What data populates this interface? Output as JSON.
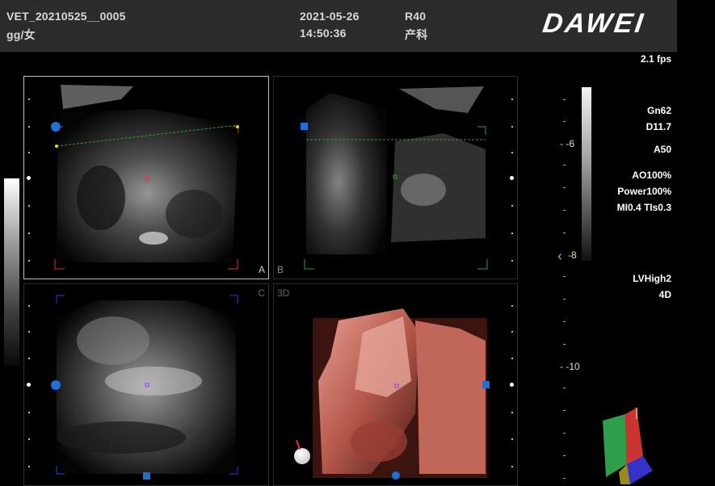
{
  "header": {
    "file_id": "VET_20210525__0005",
    "patient": "gg/女",
    "date": "2021-05-26",
    "time": "14:50:36",
    "probe": "R40",
    "department": "产科",
    "brand": "DAWEI"
  },
  "fps": "2.1 fps",
  "panels": {
    "a": "A",
    "b": "B",
    "c": "C",
    "d": "3D"
  },
  "depth_scale": {
    "d6": "6",
    "d8": "8",
    "d10": "10"
  },
  "params": {
    "gain": "Gn62",
    "depth": "D11.7",
    "angle": "A50",
    "acoustic_output": "AO100%",
    "power": "Power100%",
    "mi_tis": "MI0.4 TIs0.3",
    "render": "LVHigh2",
    "mode": "4D"
  }
}
